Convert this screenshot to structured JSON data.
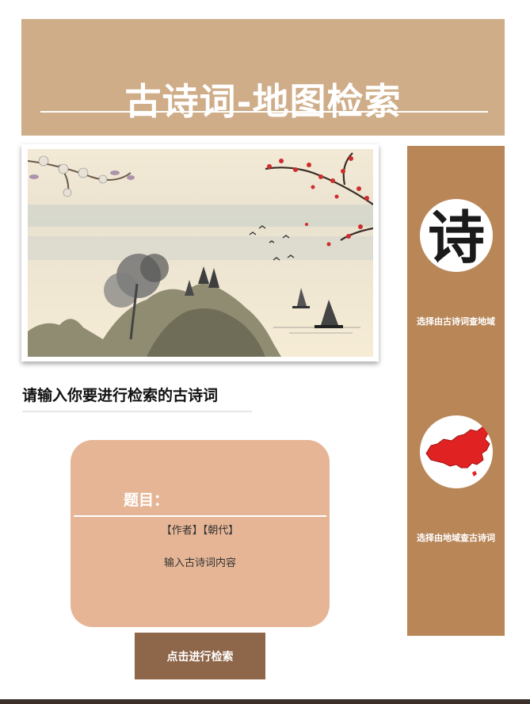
{
  "header": {
    "title": "古诗词-地图检索"
  },
  "main": {
    "prompt": "请输入你要进行检索的古诗词",
    "card": {
      "title": "题目：",
      "meta": "【作者】【朝代】",
      "content": "输入古诗词内容"
    },
    "search_button": "点击进行检索"
  },
  "sidebar": {
    "items": [
      {
        "icon": "poem-calligraphy-icon",
        "label": "选择由古诗词查地域"
      },
      {
        "icon": "china-map-icon",
        "label": "选择由地域查古诗词"
      }
    ]
  },
  "colors": {
    "header_bg": "#cead88",
    "sidebar_bg": "#b98658",
    "card_bg": "#e6b595",
    "button_bg": "#8e6649"
  }
}
